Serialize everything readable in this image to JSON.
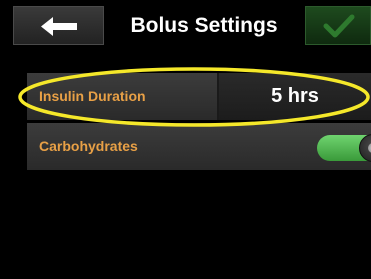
{
  "header": {
    "back_icon": "arrow-left-icon",
    "title": "Bolus Settings",
    "confirm_icon": "checkmark-icon"
  },
  "settings": [
    {
      "label": "Insulin Duration",
      "value": "5 hrs",
      "highlighted": true
    },
    {
      "label": "Carbohydrates",
      "toggle_on": true
    }
  ],
  "colors": {
    "label": "#e8a046",
    "toggle_on": "#4fb84f",
    "confirm": "#1e4a1e",
    "highlight": "#f5e82a"
  }
}
